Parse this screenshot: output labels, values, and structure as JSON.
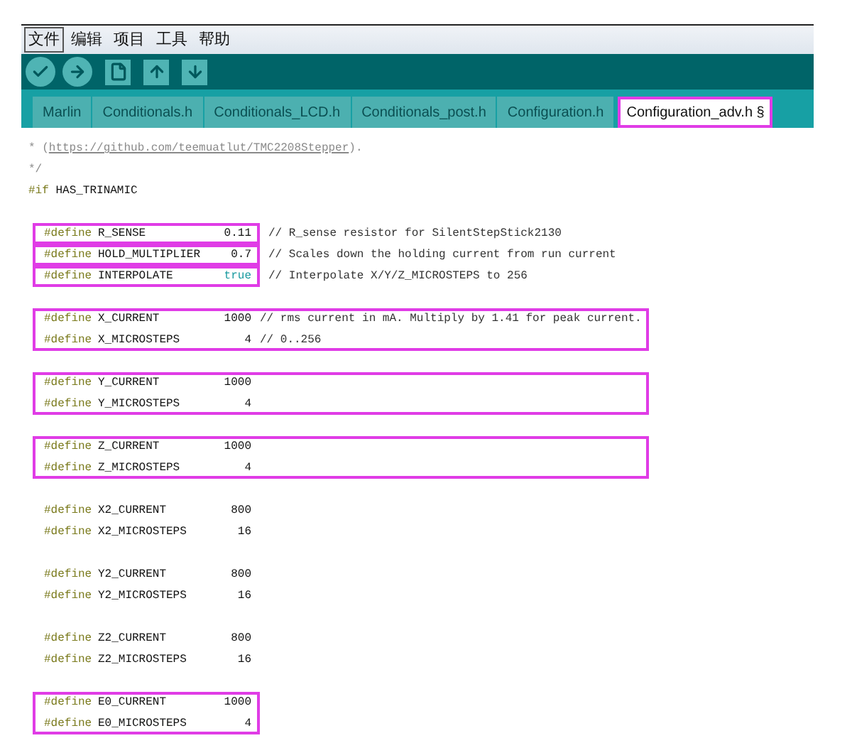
{
  "menu": [
    {
      "label": "文件",
      "selected": true
    },
    {
      "label": "编辑",
      "selected": false
    },
    {
      "label": "项目",
      "selected": false
    },
    {
      "label": "工具",
      "selected": false
    },
    {
      "label": "帮助",
      "selected": false
    }
  ],
  "toolbar": [
    {
      "kind": "round"
    },
    {
      "kind": "round"
    },
    {
      "kind": "square"
    },
    {
      "kind": "square"
    },
    {
      "kind": "square"
    }
  ],
  "tabs": [
    {
      "label": "Marlin",
      "selected": false,
      "highlighted": false
    },
    {
      "label": "Conditionals.h",
      "selected": false,
      "highlighted": false
    },
    {
      "label": "Conditionals_LCD.h",
      "selected": false,
      "highlighted": false
    },
    {
      "label": "Conditionals_post.h",
      "selected": false,
      "highlighted": false
    },
    {
      "label": "Configuration.h",
      "selected": false,
      "highlighted": false
    },
    {
      "label": "Configuration_adv.h §",
      "selected": true,
      "highlighted": true
    }
  ],
  "code": [
    {
      "kind": "link_comment",
      "lead": "* (",
      "link": "https://github.com/teemuatlut/TMC2208Stepper",
      "tail": ")."
    },
    {
      "kind": "comment",
      "text": "*/"
    },
    {
      "kind": "directive",
      "keyword": "#if",
      "text": "HAS_TRINAMIC"
    },
    {
      "kind": "blank"
    },
    {
      "kind": "group",
      "framed": true,
      "wide": false,
      "lines": [
        {
          "keyword": "#define",
          "name": "R_SENSE",
          "value": "0.11",
          "literal": false,
          "comment": "// R_sense resistor for SilentStepStick2130"
        }
      ]
    },
    {
      "kind": "group",
      "framed": true,
      "wide": false,
      "lines": [
        {
          "keyword": "#define",
          "name": "HOLD_MULTIPLIER",
          "value": "0.7",
          "literal": false,
          "comment": "// Scales down the holding current from run current"
        }
      ]
    },
    {
      "kind": "group",
      "framed": true,
      "wide": false,
      "lines": [
        {
          "keyword": "#define",
          "name": "INTERPOLATE",
          "value": "true",
          "literal": true,
          "comment": "// Interpolate X/Y/Z_MICROSTEPS to 256"
        }
      ]
    },
    {
      "kind": "blank"
    },
    {
      "kind": "group",
      "framed": true,
      "wide": true,
      "lines": [
        {
          "keyword": "#define",
          "name": "X_CURRENT",
          "value": "1000",
          "literal": false,
          "comment": "// rms current in mA. Multiply by 1.41 for peak current."
        },
        {
          "keyword": "#define",
          "name": "X_MICROSTEPS",
          "value": "4",
          "literal": false,
          "comment": "// 0..256"
        }
      ]
    },
    {
      "kind": "blank"
    },
    {
      "kind": "group",
      "framed": true,
      "wide": true,
      "lines": [
        {
          "keyword": "#define",
          "name": "Y_CURRENT",
          "value": "1000",
          "literal": false
        },
        {
          "keyword": "#define",
          "name": "Y_MICROSTEPS",
          "value": "4",
          "literal": false
        }
      ]
    },
    {
      "kind": "blank"
    },
    {
      "kind": "group",
      "framed": true,
      "wide": true,
      "lines": [
        {
          "keyword": "#define",
          "name": "Z_CURRENT",
          "value": "1000",
          "literal": false
        },
        {
          "keyword": "#define",
          "name": "Z_MICROSTEPS",
          "value": "4",
          "literal": false
        }
      ]
    },
    {
      "kind": "blank"
    },
    {
      "kind": "group",
      "framed": false,
      "lines": [
        {
          "keyword": "#define",
          "name": "X2_CURRENT",
          "value": "800",
          "literal": false
        },
        {
          "keyword": "#define",
          "name": "X2_MICROSTEPS",
          "value": "16",
          "literal": false
        }
      ]
    },
    {
      "kind": "blank"
    },
    {
      "kind": "group",
      "framed": false,
      "lines": [
        {
          "keyword": "#define",
          "name": "Y2_CURRENT",
          "value": "800",
          "literal": false
        },
        {
          "keyword": "#define",
          "name": "Y2_MICROSTEPS",
          "value": "16",
          "literal": false
        }
      ]
    },
    {
      "kind": "blank"
    },
    {
      "kind": "group",
      "framed": false,
      "lines": [
        {
          "keyword": "#define",
          "name": "Z2_CURRENT",
          "value": "800",
          "literal": false
        },
        {
          "keyword": "#define",
          "name": "Z2_MICROSTEPS",
          "value": "16",
          "literal": false
        }
      ]
    },
    {
      "kind": "blank"
    },
    {
      "kind": "group",
      "framed": true,
      "wide": false,
      "lines": [
        {
          "keyword": "#define",
          "name": "E0_CURRENT",
          "value": "1000",
          "literal": false
        },
        {
          "keyword": "#define",
          "name": "E0_MICROSTEPS",
          "value": "4",
          "literal": false
        }
      ]
    }
  ]
}
